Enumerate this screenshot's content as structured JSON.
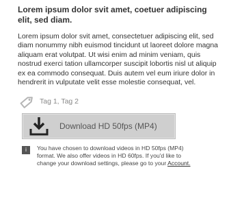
{
  "article": {
    "title": "Lorem ipsum dolor svit amet, coetuer adipiscing elit, sed diam.",
    "body": "Lorem ipsum dolor svit amet, consectetuer adipiscing elit, sed diam nonummy nibh euismod tincidunt ut laoreet dolore magna aliquam erat volutpat. Ut wisi enim ad minim veniam, quis nostrud exerci tation ullamcorper suscipit lobortis nisl ut aliquip ex ea commodo consequat. Duis autem vel eum iriure dolor in hendrerit in vulputate velit esse molestie consequat, vel."
  },
  "tags": {
    "icon": "tag-icon",
    "label": "Tag 1, Tag 2"
  },
  "download": {
    "icon": "download-icon",
    "label": "Download HD 50fps (MP4)"
  },
  "notice": {
    "icon": "info-icon",
    "icon_glyph": "i",
    "text": "You have chosen to download videos in HD 50fps (MP4) format. We also offer videos in HD 60fps. If you'd like to change your download settings, please go to your ",
    "link_label": "Account."
  },
  "colors": {
    "button_bg": "#cfcfcf",
    "info_icon_bg": "#555555",
    "text": "#333333",
    "muted_text": "#888888"
  }
}
